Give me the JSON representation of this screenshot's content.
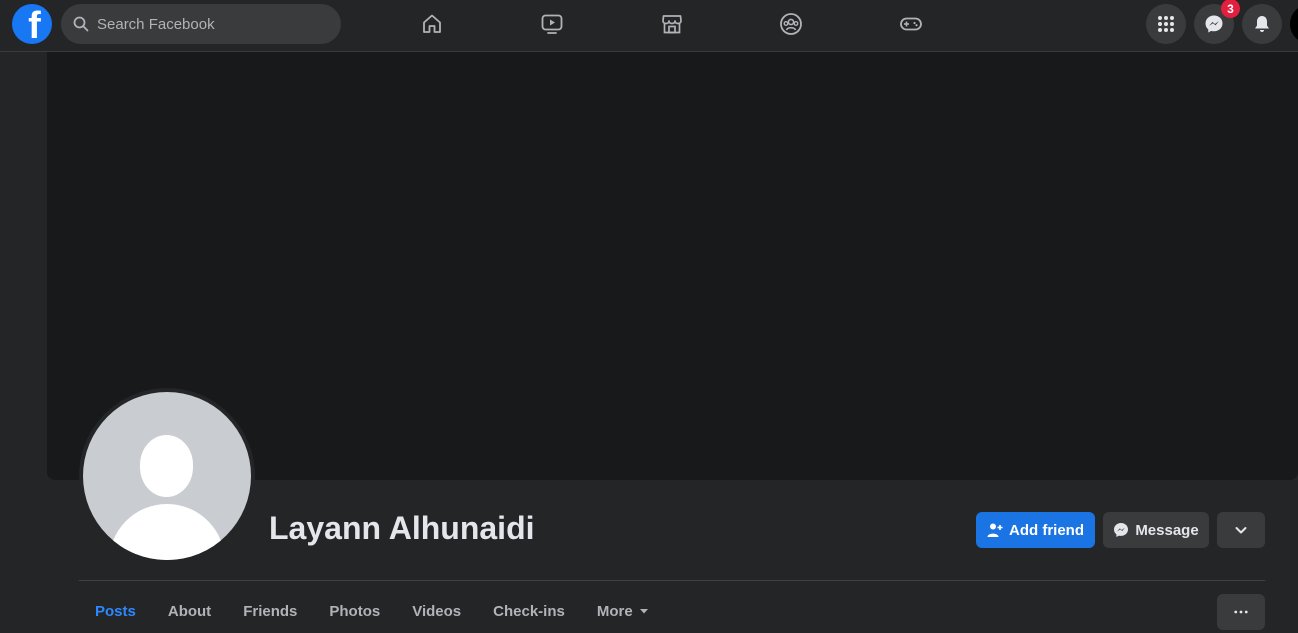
{
  "topbar": {
    "logo_letter": "f",
    "search": {
      "placeholder": "Search Facebook",
      "icon": "search-icon"
    },
    "nav_icons": [
      "home-icon",
      "watch-icon",
      "marketplace-icon",
      "groups-icon",
      "gaming-icon"
    ],
    "right_buttons": [
      {
        "icon": "menu-grid-icon"
      },
      {
        "icon": "messenger-icon",
        "badge": "3"
      },
      {
        "icon": "bell-icon"
      }
    ]
  },
  "profile": {
    "name": "Layann Alhunaidi",
    "add_friend_label": "Add friend",
    "message_label": "Message",
    "tabs": [
      {
        "label": "Posts",
        "active": true
      },
      {
        "label": "About"
      },
      {
        "label": "Friends"
      },
      {
        "label": "Photos"
      },
      {
        "label": "Videos"
      },
      {
        "label": "Check-ins"
      },
      {
        "label": "More",
        "caret": true
      }
    ]
  },
  "colors": {
    "page_bg": "#18191a",
    "surface": "#242526",
    "button_bg": "#3a3b3c",
    "accent": "#1b74e4",
    "active_tab": "#2d88ff",
    "badge": "#e41e3f"
  }
}
